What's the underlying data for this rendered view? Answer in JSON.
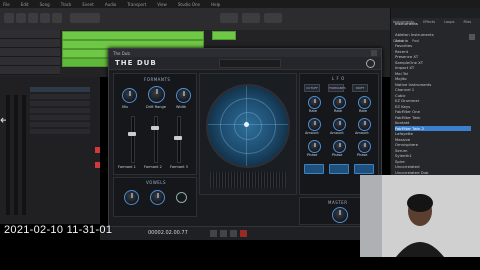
{
  "menubar": {
    "items": [
      "File",
      "Edit",
      "Song",
      "Track",
      "Event",
      "Audio",
      "Transport",
      "View",
      "Studio One",
      "Help"
    ]
  },
  "plugin": {
    "window_title": "The Dub",
    "brand": "THE DUB",
    "sections": {
      "formants": "FORMANTS",
      "lfo": "L F O",
      "vowels": "VOWELS",
      "master": "MASTER"
    },
    "formant_knobs": [
      "Mix",
      "Drift Range",
      "Width"
    ],
    "formant_buttons": [
      "Formant 1",
      "Formant 2",
      "Formant 3"
    ],
    "lfo_tabs": [
      "CUTOFF",
      "FORMANTS",
      "DRIFT"
    ],
    "lfo_knob_labels": [
      "Rate",
      "Rate",
      "Rate",
      "Amount",
      "Amount",
      "Amount",
      "Phase",
      "Phase",
      "Phase"
    ]
  },
  "browser": {
    "tabs": [
      "Instruments",
      "Effects",
      "Loops",
      "Files",
      "Cloud",
      "Pool"
    ],
    "header": "Instruments",
    "items": [
      "Ableton Instruments",
      "Arturia",
      "Favorites",
      "Recent",
      "Presence XT",
      "SampleOne XT",
      "Impact XT",
      "Mai Tai",
      "Mojito",
      "Native Instruments",
      "Channel 1",
      "Cubic",
      "EZ Drummer",
      "EZ Keys",
      "FabFilter One",
      "FabFilter Twin",
      "Kontakt",
      "FabFilter Twin 2",
      "Lafayette",
      "Massive",
      "Omnisphere",
      "Serum",
      "Sylenth1",
      "Spire",
      "Uncorrelated",
      "Uncorrelated Dub",
      "Uncorrelated Plus",
      "Vital"
    ],
    "selected_index": 17
  },
  "timestamp": "2021-02-10 11-31-01",
  "transport": {
    "time": "00002.02.00.77"
  },
  "colors": {
    "accent": "#3b7fcf",
    "clip_green": "#6fc845"
  }
}
